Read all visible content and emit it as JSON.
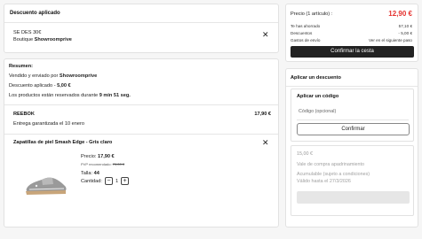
{
  "discount_card": {
    "title": "Descuento aplicado",
    "code_line": "SE DES 30€",
    "store_prefix": "Boutique ",
    "store_name": "Showroomprive"
  },
  "summary": {
    "heading": "Resumen:",
    "sold_by_prefix": "Vendido y enviado por ",
    "sold_by_name": "Showroomprive",
    "discount_prefix": "Descuento aplicado - ",
    "discount_value": "5,00 €",
    "reserved_prefix": "Los productos están reservados durante ",
    "reserved_time": "9 min 51 seg."
  },
  "shipment": {
    "brand": "REEBOK",
    "price": "17,90 €",
    "delivery": "Entrega garantizada el 10 enero"
  },
  "product": {
    "name": "Zapatillas de piel Smash Edge - Gris claro",
    "price_label": "Precio: ",
    "price": "17,90 €",
    "rrp_label": "PVP recomendado: ",
    "rrp": "70,00 €",
    "size_label": "Talla: ",
    "size": "44",
    "qty_label": "Cantidad:",
    "qty": "1",
    "minus": "−",
    "plus": "+"
  },
  "order": {
    "price_label": "Precio (1 artículo) :",
    "price": "12,90 €",
    "rows": [
      {
        "label": "Te has ahorrado",
        "value": "57,10 €"
      },
      {
        "label": "Descuentos",
        "value": "- 5,00 €"
      },
      {
        "label": "Gastos de envío",
        "value": "Ver en el siguiente paso"
      }
    ],
    "confirm_button": "Confirmar la cesta"
  },
  "apply_discount": {
    "title": "Aplicar un descuento",
    "code_title": "Aplicar un código",
    "code_placeholder": "Código (opcional)",
    "confirm": "Confirmar",
    "voucher_amount": "15,00 €",
    "voucher_lines": [
      "Vale de compra apadrinamiento",
      "Acumulable (sujeto a condiciones)",
      "Válido hasta el 27/3/2026"
    ]
  },
  "colors": {
    "price_red": "#e5322f",
    "dark_button": "#222222"
  }
}
